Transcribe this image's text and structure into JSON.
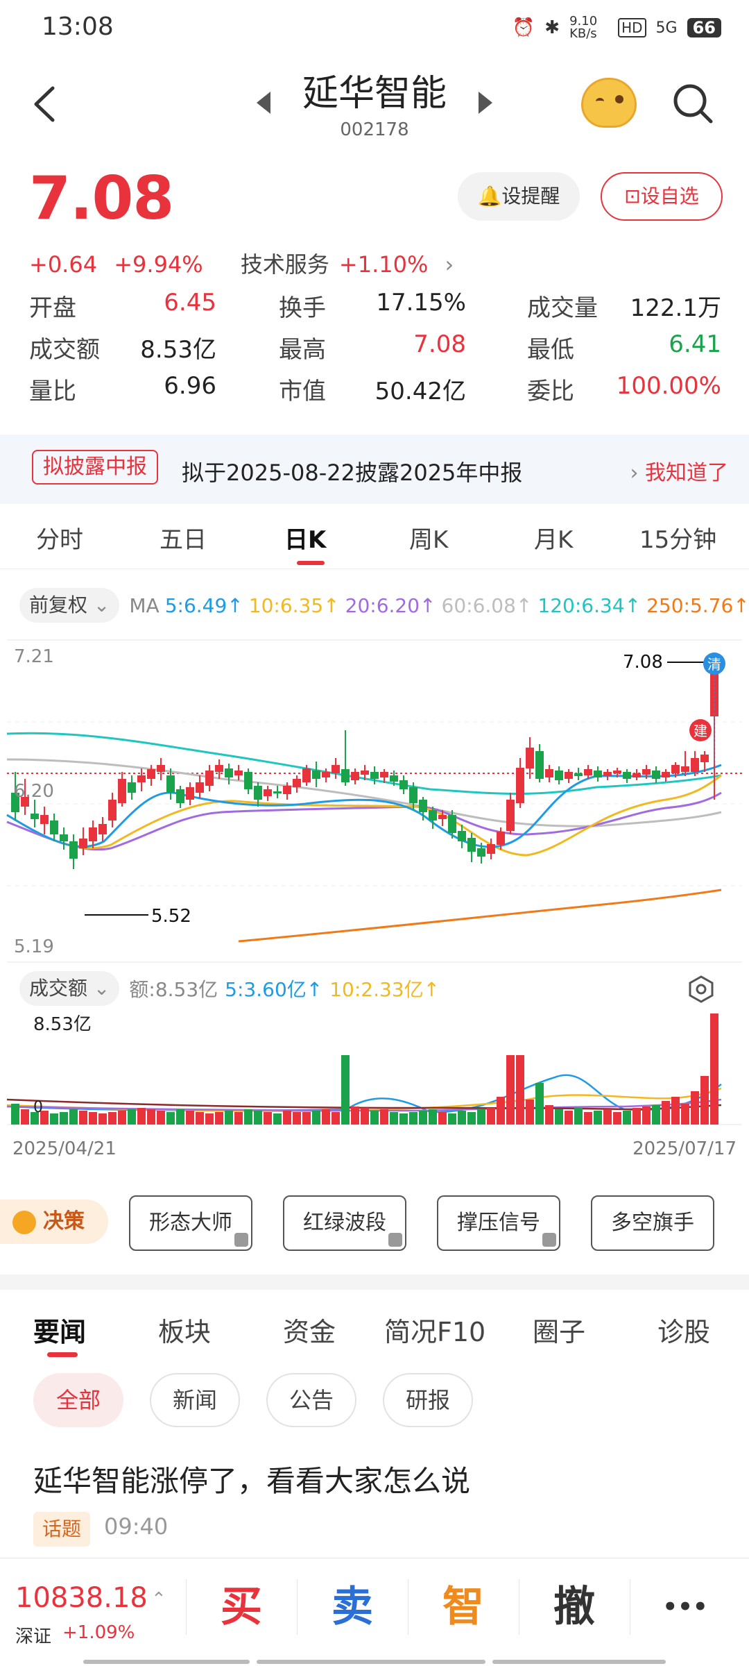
{
  "status": {
    "time": "13:08",
    "net_speed": "9.10 KB/s",
    "hd": "HD",
    "signal": "5G",
    "battery": "66"
  },
  "header": {
    "name": "延华智能",
    "code": "002178"
  },
  "quote": {
    "price": "7.08",
    "change": "+0.64",
    "change_pct": "+9.94%",
    "sector": "技术服务",
    "sector_change": "+1.10%",
    "alert_label": "设提醒",
    "watch_label": "设自选"
  },
  "stats": [
    {
      "label": "开盘",
      "value": "6.45",
      "color": "red"
    },
    {
      "label": "换手",
      "value": "17.15%",
      "color": "plain"
    },
    {
      "label": "成交量",
      "value": "122.1万",
      "color": "plain"
    },
    {
      "label": "成交额",
      "value": "8.53亿",
      "color": "plain"
    },
    {
      "label": "最高",
      "value": "7.08",
      "color": "red"
    },
    {
      "label": "最低",
      "value": "6.41",
      "color": "green"
    },
    {
      "label": "量比",
      "value": "6.96",
      "color": "plain"
    },
    {
      "label": "市值",
      "value": "50.42亿",
      "color": "plain"
    },
    {
      "label": "委比",
      "value": "100.00%",
      "color": "red"
    }
  ],
  "notice": {
    "tag": "拟披露中报",
    "text": "拟于2025-08-22披露2025年中报",
    "action": "我知道了"
  },
  "period_tabs": [
    "分时",
    "五日",
    "日K",
    "周K",
    "月K",
    "15分钟"
  ],
  "ma": {
    "adjust": "前复权",
    "label": "MA",
    "items": [
      {
        "text": "5:6.49↑",
        "color": "#1e9be6"
      },
      {
        "text": "10:6.35↑",
        "color": "#f2b81f"
      },
      {
        "text": "20:6.20↑",
        "color": "#a06be0"
      },
      {
        "text": "60:6.08↑",
        "color": "#bdbdbd"
      },
      {
        "text": "120:6.34↑",
        "color": "#1fc6c0"
      },
      {
        "text": "250:5.76↑",
        "color": "#f07a18"
      }
    ]
  },
  "kline": {
    "y_top": "7.21",
    "y_mid": "6.20",
    "y_bottom": "5.19",
    "high_label": "7.08",
    "low_label": "5.52",
    "badge_clear": "清",
    "badge_build": "建"
  },
  "volume": {
    "dropdown": "成交额",
    "amount": "额:8.53亿",
    "ma5": "5:3.60亿↑",
    "ma10": "10:2.33亿↑",
    "max_label": "8.53亿",
    "zero_label": "0",
    "date_start": "2025/04/21",
    "date_end": "2025/07/17"
  },
  "tools": {
    "decision": "决策",
    "buttons": [
      "形态大师",
      "红绿波段",
      "撑压信号",
      "多空旗手"
    ]
  },
  "news_tabs": [
    "要闻",
    "板块",
    "资金",
    "简况F10",
    "圈子",
    "诊股"
  ],
  "filters": [
    "全部",
    "新闻",
    "公告",
    "研报"
  ],
  "news": {
    "headline": "延华智能涨停了，看看大家怎么说",
    "tag": "话题",
    "time": "09:40"
  },
  "bottom": {
    "index_value": "10838.18",
    "index_name": "深证",
    "index_change": "+1.09%",
    "buy": "买",
    "sell": "卖",
    "smart": "智",
    "cancel": "撤",
    "more": "•••"
  },
  "colors": {
    "up": "#e8323c",
    "down": "#1aa34a"
  }
}
